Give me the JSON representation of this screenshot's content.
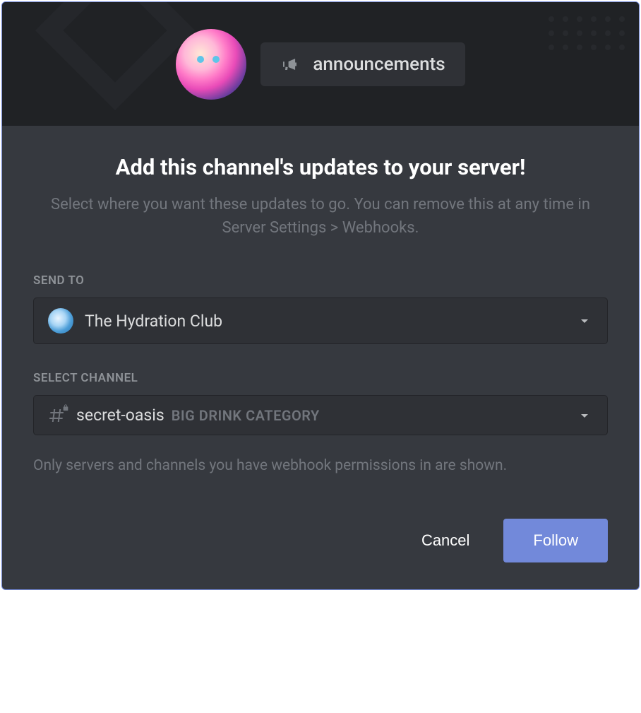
{
  "header": {
    "channel_name": "announcements"
  },
  "content": {
    "title": "Add this channel's updates to your server!",
    "subtitle": "Select where you want these updates to go. You can remove this at any time in Server Settings > Webhooks.",
    "send_to_label": "SEND TO",
    "send_to_value": "The Hydration Club",
    "select_channel_label": "SELECT CHANNEL",
    "select_channel_value": "secret-oasis",
    "select_channel_category": "BIG DRINK CATEGORY",
    "help_text": "Only servers and channels you have webhook permissions in are shown."
  },
  "footer": {
    "cancel_label": "Cancel",
    "follow_label": "Follow"
  }
}
